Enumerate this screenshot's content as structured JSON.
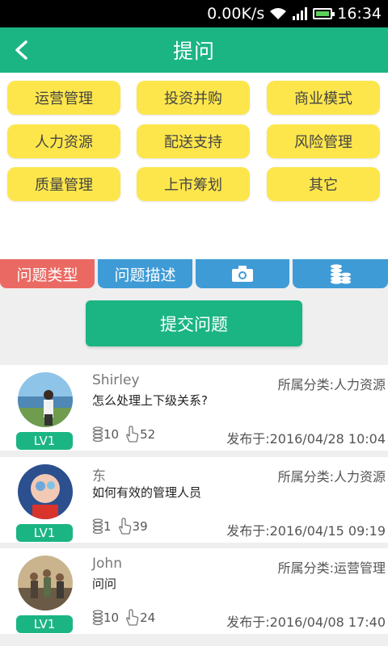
{
  "status_bar": {
    "speed": "0.00K/s",
    "time": "16:34"
  },
  "header": {
    "title": "提问"
  },
  "categories": [
    "运营管理",
    "投资并购",
    "商业模式",
    "人力资源",
    "配送支持",
    "风险管理",
    "质量管理",
    "上市筹划",
    "其它"
  ],
  "tabs": [
    {
      "label": "问题类型",
      "color": "#ea6a63"
    },
    {
      "label": "问题描述",
      "color": "#3f9bd6"
    },
    {
      "label": "",
      "color": "#3f9bd6",
      "icon": "camera-icon"
    },
    {
      "label": "",
      "color": "#3f9bd6",
      "icon": "coins-icon"
    }
  ],
  "submit_label": "提交问题",
  "questions": [
    {
      "user": "Shirley",
      "category": "所属分类:人力资源",
      "question": "怎么处理上下级关系?",
      "coins": "10",
      "likes": "52",
      "date": "发布于:2016/04/28 10:04",
      "level": "LV1"
    },
    {
      "user": "东",
      "category": "所属分类:人力资源",
      "question": "如何有效的管理人员",
      "coins": "1",
      "likes": "39",
      "date": "发布于:2016/04/15 09:19",
      "level": "LV1"
    },
    {
      "user": "John",
      "category": "所属分类:运营管理",
      "question": "问问",
      "coins": "10",
      "likes": "24",
      "date": "发布于:2016/04/08 17:40",
      "level": "LV1"
    }
  ],
  "colors": {
    "primary": "#1bb583",
    "yellow": "#fde64b",
    "red_tab": "#ea6a63",
    "blue_tab": "#3f9bd6"
  }
}
